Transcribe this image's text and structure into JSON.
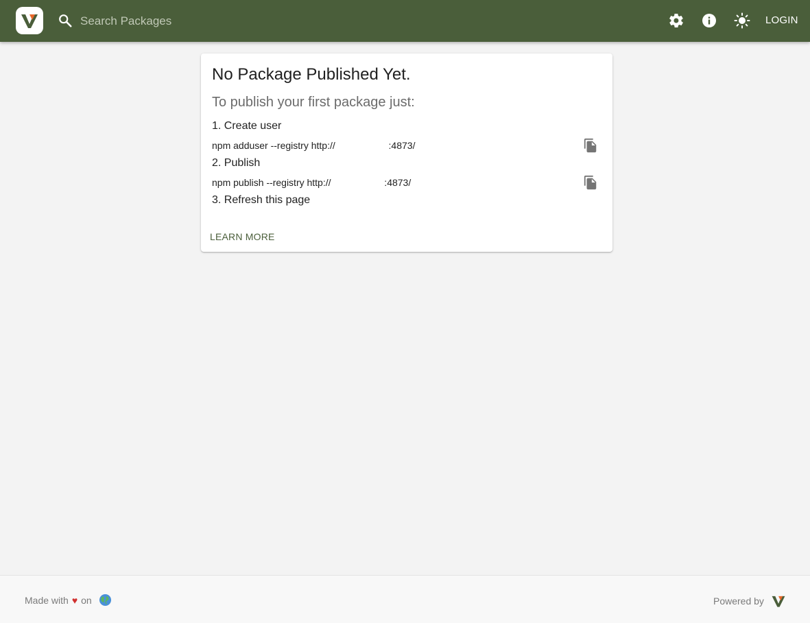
{
  "header": {
    "search": {
      "placeholder": "Search Packages",
      "value": ""
    },
    "icons": [
      "settings-icon",
      "info-icon",
      "theme-toggle-icon"
    ],
    "login_label": "LOGIN",
    "brand_color": "#4a5e3a"
  },
  "card": {
    "title": "No Package Published Yet.",
    "subtitle": "To publish your first package just:",
    "steps": [
      {
        "label": "1. Create user",
        "command": "npm adduser --registry http://                    :4873/"
      },
      {
        "label": "2. Publish",
        "command": "npm publish --registry http://                    :4873/"
      },
      {
        "label": "3. Refresh this page"
      }
    ],
    "learn_more_label": "LEARN MORE"
  },
  "footer": {
    "made_with": "Made with",
    "heart": "♥",
    "on": "on",
    "powered_by": "Powered by"
  }
}
